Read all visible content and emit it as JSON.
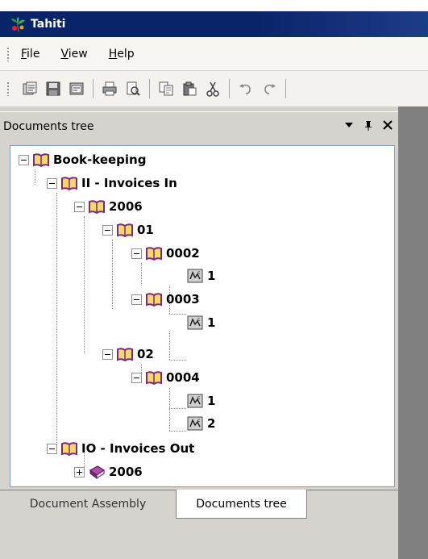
{
  "window": {
    "title": "Tahiti",
    "icon": "tahiti-app-icon"
  },
  "menu": {
    "items": [
      {
        "id": "file",
        "label": "File"
      },
      {
        "id": "view",
        "label": "View"
      },
      {
        "id": "help",
        "label": "Help"
      }
    ]
  },
  "toolbar": {
    "buttons": [
      "new-document-icon",
      "save-icon",
      "properties-icon",
      "print-icon",
      "print-preview-icon",
      "copy-icon",
      "paste-icon",
      "cut-icon",
      "undo-icon",
      "redo-icon"
    ]
  },
  "panel": {
    "title": "Documents tree",
    "dropdown_glyph": "▾",
    "pin_glyph": "ᵖ",
    "close_glyph": "✕"
  },
  "tree": {
    "book_keeping": "Book-keeping",
    "invoices_in": "II - Invoices In",
    "year_2006": "2006",
    "month_01": "01",
    "doc_0002": "0002",
    "doc_0002_page1": "1",
    "doc_0003": "0003",
    "doc_0003_page1": "1",
    "month_02": "02",
    "doc_0004": "0004",
    "doc_0004_page1": "1",
    "doc_0004_page2": "2",
    "invoices_out": "IO - Invoices Out",
    "out_year_2006": "2006"
  },
  "tabs": {
    "document_assembly": "Document Assembly",
    "documents_tree": "Documents tree"
  }
}
